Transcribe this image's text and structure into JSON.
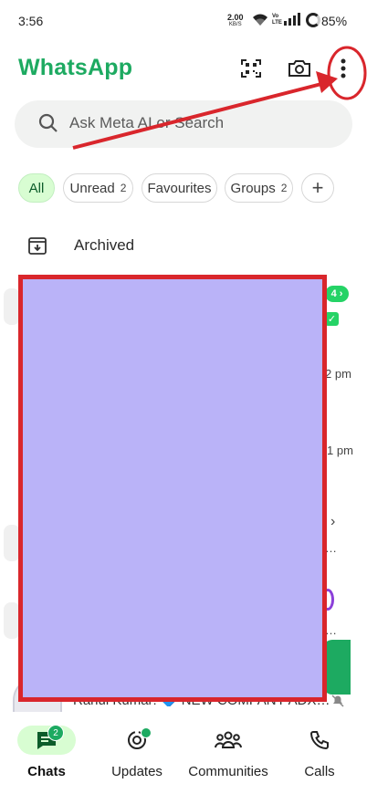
{
  "status_bar": {
    "time": "3:56",
    "network_speed": "2.00",
    "network_unit": "KB/S",
    "volte": "Vo LTE",
    "battery": "85%"
  },
  "header": {
    "title": "WhatsApp",
    "icons": [
      "qr-scan-icon",
      "camera-icon",
      "more-vert-icon"
    ]
  },
  "search": {
    "placeholder": "Ask Meta AI or Search"
  },
  "filters": [
    {
      "label": "All",
      "count": ""
    },
    {
      "label": "Unread",
      "count": "2"
    },
    {
      "label": "Favourites",
      "count": ""
    },
    {
      "label": "Groups",
      "count": "2"
    }
  ],
  "archived": {
    "label": "Archived"
  },
  "chat_peek": {
    "unread_chip": "4 ›",
    "time_1": "2 pm",
    "time_2": "1 pm",
    "ellipsis": "…",
    "bottom_snippet": "Rahul Kumar: 🔷 NEW COMPANY ADX…"
  },
  "bottom_nav": [
    {
      "label": "Chats",
      "badge": "2"
    },
    {
      "label": "Updates"
    },
    {
      "label": "Communities"
    },
    {
      "label": "Calls"
    }
  ],
  "colors": {
    "brand": "#1daa61",
    "chip_active_bg": "#d8fdd2",
    "redaction_fill": "#bab3f8",
    "annotation_red": "#d9262c"
  }
}
